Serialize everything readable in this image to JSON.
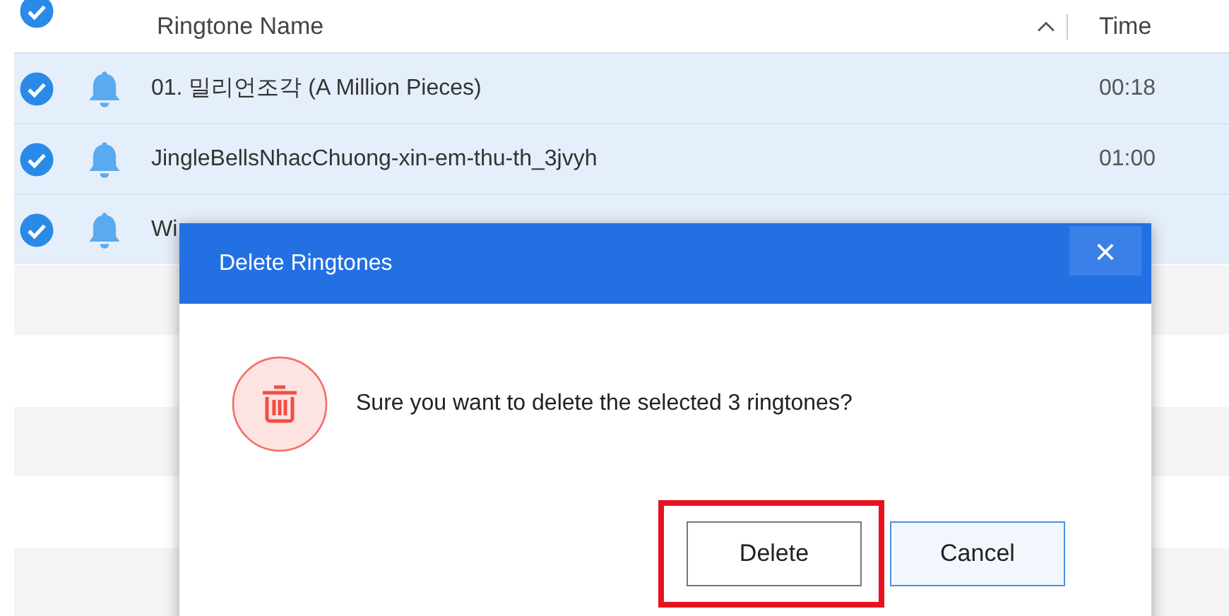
{
  "table": {
    "columns": [
      {
        "label": "Ringtone Name",
        "sorted": true
      },
      {
        "label": "Time"
      }
    ],
    "header_checked": true,
    "rows": [
      {
        "name": "01. 밀리언조각 (A Million Pieces)",
        "time": "00:18",
        "checked": true,
        "selected": true
      },
      {
        "name": "JingleBellsNhacChuong-xin-em-thu-th_3jvyh",
        "time": "01:00",
        "checked": true,
        "selected": true
      },
      {
        "name": "Wi",
        "checked": true,
        "selected": true
      }
    ]
  },
  "dialog": {
    "title": "Delete Ringtones",
    "close": "×",
    "message": "Sure you want to delete the selected 3 ringtones?",
    "buttons": [
      {
        "label": "Delete",
        "highlighted": true,
        "kind": "default"
      },
      {
        "label": "Cancel",
        "highlighted": false,
        "kind": "focused"
      }
    ]
  }
}
